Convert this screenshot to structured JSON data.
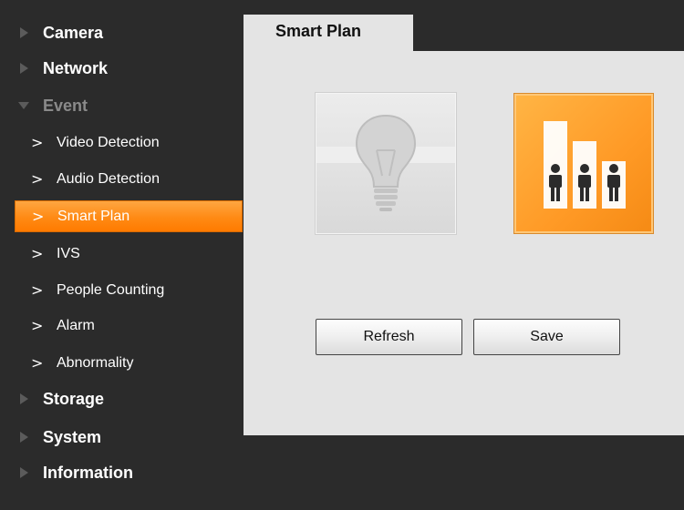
{
  "sidebar": {
    "items": [
      {
        "label": "Camera"
      },
      {
        "label": "Network"
      },
      {
        "label": "Event"
      },
      {
        "label": "Storage"
      },
      {
        "label": "System"
      },
      {
        "label": "Information"
      }
    ],
    "event_subitems": [
      {
        "label": "Video Detection"
      },
      {
        "label": "Audio Detection"
      },
      {
        "label": "Smart Plan"
      },
      {
        "label": "IVS"
      },
      {
        "label": "People Counting"
      },
      {
        "label": "Alarm"
      },
      {
        "label": "Abnormality"
      }
    ],
    "active_subitem": "Smart Plan",
    "chevron": ">"
  },
  "tabs": [
    {
      "label": "Smart Plan"
    }
  ],
  "main": {
    "plans": [
      {
        "icon": "light-bulb-icon",
        "state": "inactive"
      },
      {
        "icon": "people-counting-icon",
        "state": "selected"
      }
    ],
    "refresh_label": "Refresh",
    "save_label": "Save"
  },
  "colors": {
    "accent": "#ff8a14",
    "sidebar_bg": "#2b2b2b",
    "panel_bg": "#e4e4e4"
  }
}
